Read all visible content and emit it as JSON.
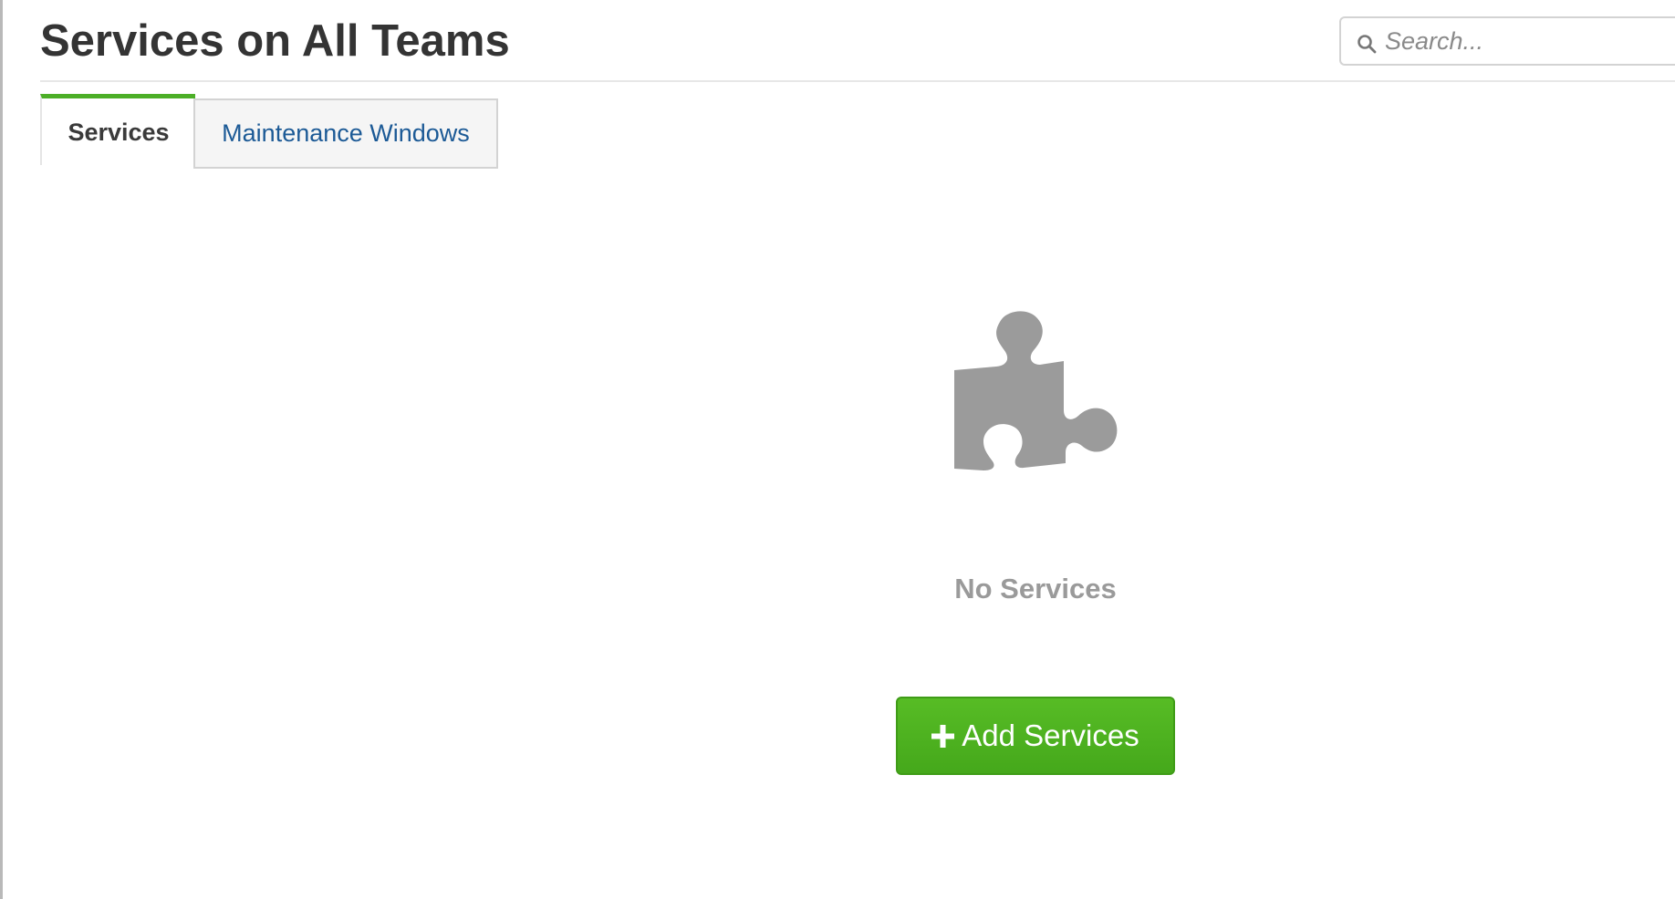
{
  "page": {
    "title": "Services on All Teams"
  },
  "search": {
    "placeholder": "Search...",
    "icon": "search-icon"
  },
  "tabs": [
    {
      "label": "Services",
      "active": true
    },
    {
      "label": "Maintenance Windows",
      "active": false
    }
  ],
  "empty_state": {
    "icon": "puzzle-piece-icon",
    "message": "No Services",
    "button_label": "Add Services",
    "button_icon": "plus-icon"
  },
  "colors": {
    "accent_green": "#4caf27",
    "link_blue": "#1c5a96",
    "icon_gray": "#9b9b9b"
  }
}
